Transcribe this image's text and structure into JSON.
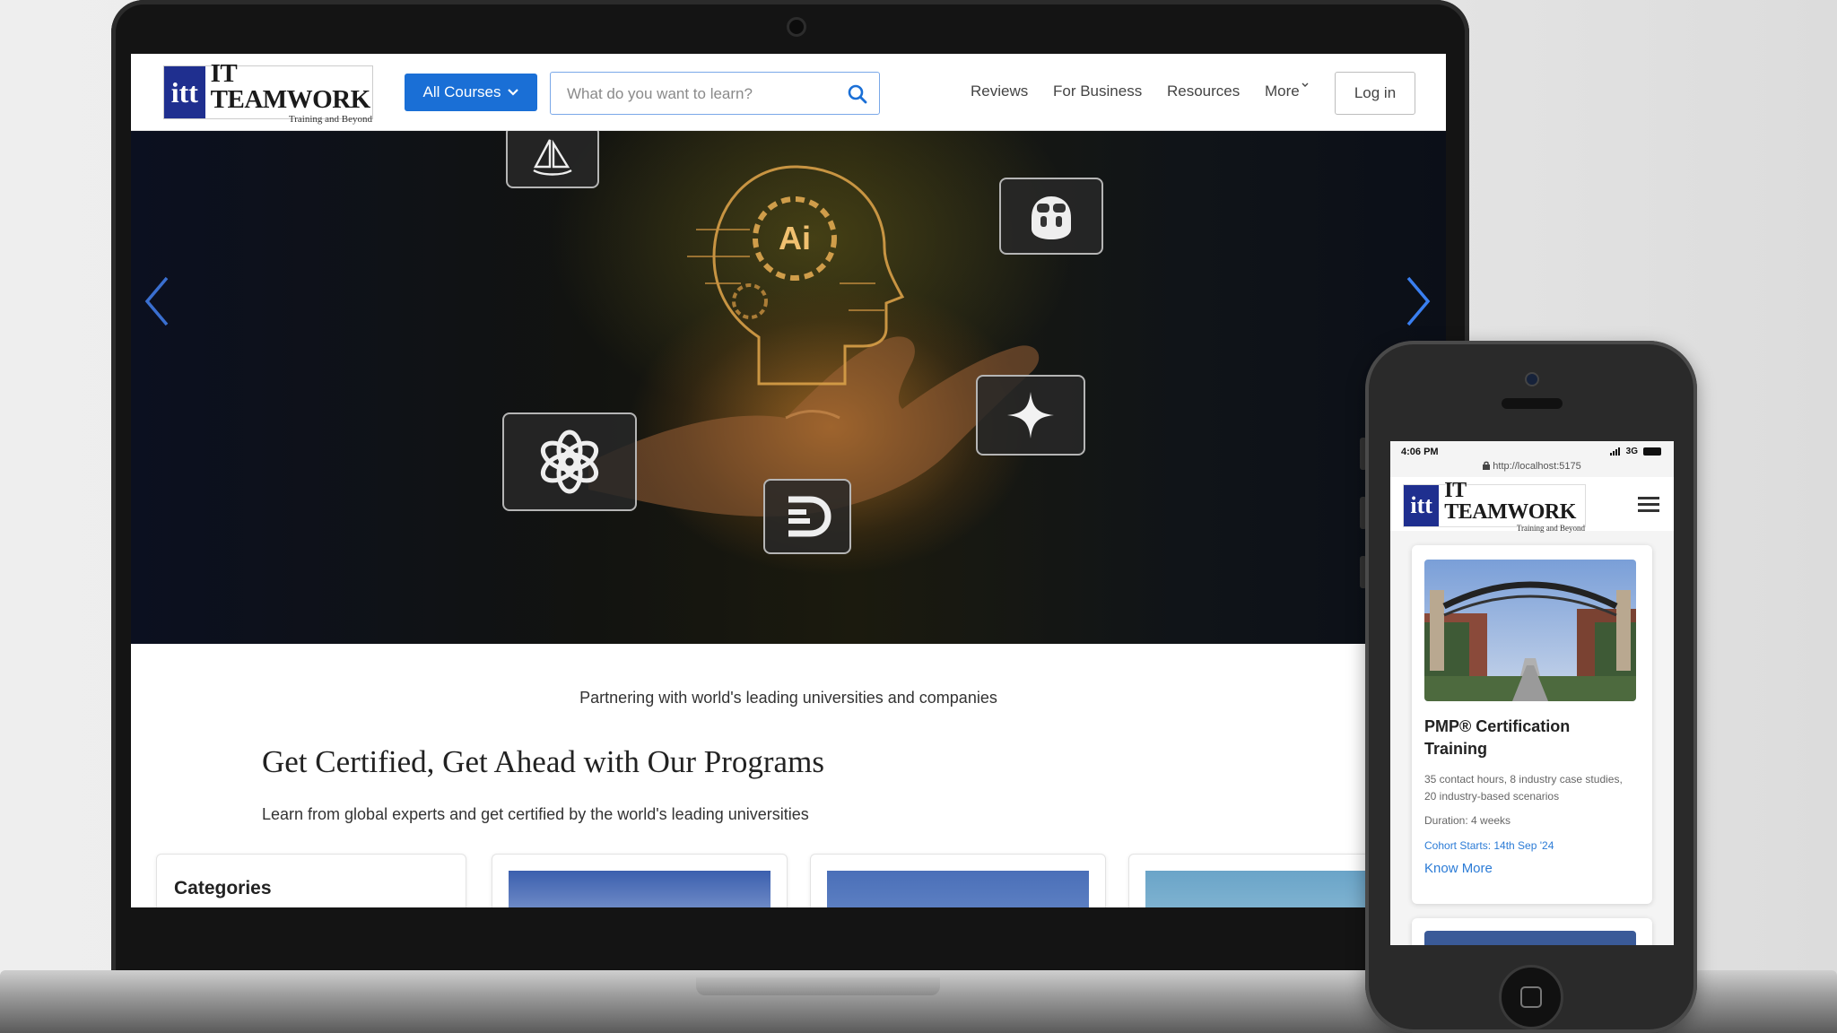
{
  "brand": {
    "mark": "itt",
    "name": "IT TEAMWORK",
    "tagline": "Training and Beyond"
  },
  "nav": {
    "all_courses": "All Courses",
    "search_placeholder": "What do you want to learn?",
    "links": [
      "Reviews",
      "For Business",
      "Resources",
      "More"
    ],
    "login": "Log in"
  },
  "hero": {
    "ai_label": "Ai",
    "tiles": [
      "sailboat-icon",
      "copilot-bot-icon",
      "openai-icon",
      "sparkle-icon",
      "d-logo-icon"
    ]
  },
  "content": {
    "partnering": "Partnering with world's leading universities and companies",
    "section_title": "Get Certified, Get Ahead with Our Programs",
    "section_subtitle": "Learn from global experts and get certified by the world's leading universities",
    "categories_title": "Categories"
  },
  "mobile": {
    "status_time": "4:06 PM",
    "status_network": "3G",
    "url": "http://localhost:5175",
    "card": {
      "title": "PMP® Certification Training",
      "description": "35 contact hours, 8 industry case studies, 20 industry-based scenarios",
      "duration": "Duration: 4 weeks",
      "cohort": "Cohort Starts: 14th Sep '24",
      "link": "Know More"
    }
  },
  "colors": {
    "brand_blue": "#1f2f8f",
    "accent_blue": "#1a6fd6",
    "link_blue": "#2b7bd6"
  }
}
